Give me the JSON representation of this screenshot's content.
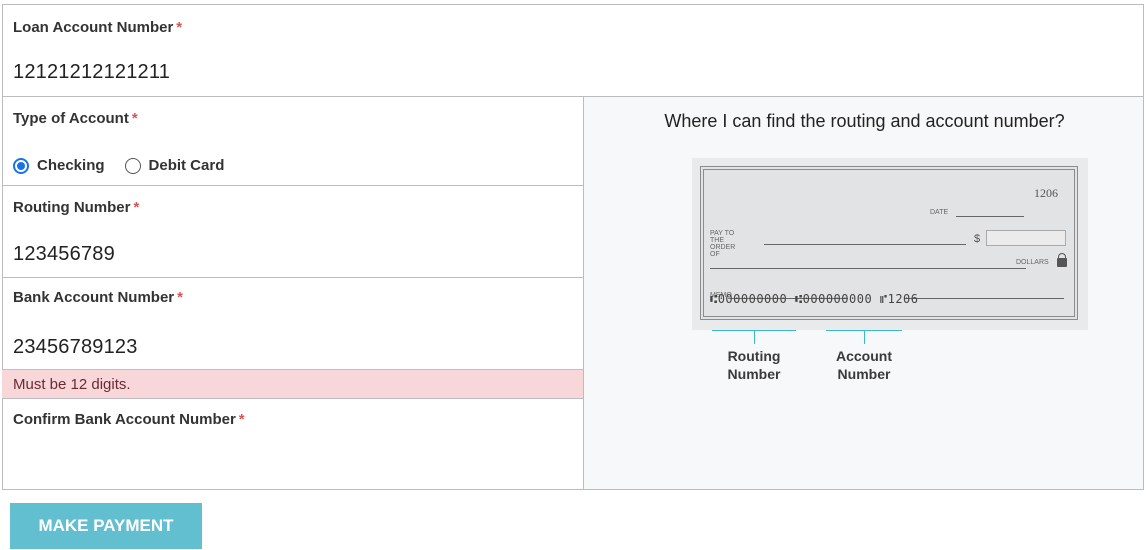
{
  "loan": {
    "label": "Loan Account Number",
    "required": "*",
    "value": "12121212121211"
  },
  "type_of_account": {
    "label": "Type of Account",
    "required": "*",
    "options": [
      {
        "label": "Checking",
        "checked": true
      },
      {
        "label": "Debit Card",
        "checked": false
      }
    ]
  },
  "routing": {
    "label": "Routing Number",
    "required": "*",
    "value": "123456789"
  },
  "bank_account": {
    "label": "Bank Account Number",
    "required": "*",
    "value": "23456789123",
    "error": "Must be 12 digits."
  },
  "confirm_bank_account": {
    "label": "Confirm Bank Account Number",
    "required": "*",
    "value": ""
  },
  "help": {
    "title": "Where I can find the routing and account number?",
    "cheque": {
      "number": "1206",
      "date_label": "DATE",
      "pay_to_label": "PAY TO THE ORDER OF",
      "dollar_sign": "$",
      "dollars_label": "DOLLARS",
      "memo_label": "MEMO",
      "micr_line": "⑆000000000  ⑆000000000  ⑈1206"
    },
    "routing_caption": "Routing Number",
    "account_caption": "Account Number"
  },
  "submit_label": "MAKE PAYMENT",
  "colors": {
    "accent": "#62bfd0",
    "required": "#d9534f",
    "error_bg": "#f8d7da",
    "radio_checked": "#1a73e8",
    "bracket": "#3bbac7"
  }
}
